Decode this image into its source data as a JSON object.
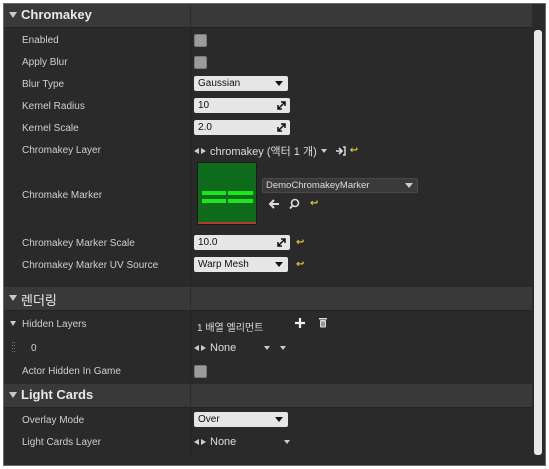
{
  "sections": {
    "chromakey": "Chromakey",
    "rendering": "렌더링",
    "light_cards": "Light Cards"
  },
  "chromakey": {
    "enabled_label": "Enabled",
    "apply_blur_label": "Apply Blur",
    "blur_type_label": "Blur Type",
    "blur_type_value": "Gaussian",
    "kernel_radius_label": "Kernel Radius",
    "kernel_radius_value": "10",
    "kernel_scale_label": "Kernel Scale",
    "kernel_scale_value": "2.0",
    "layer_label": "Chromakey Layer",
    "layer_value": "chromakey (액터 1 개)",
    "marker_label": "Chromake Marker",
    "marker_asset": "DemoChromakeyMarker",
    "marker_scale_label": "Chromakey Marker Scale",
    "marker_scale_value": "10.0",
    "uv_source_label": "Chromakey Marker UV Source",
    "uv_source_value": "Warp Mesh"
  },
  "rendering": {
    "hidden_layers_label": "Hidden Layers",
    "hidden_layers_count": "1 배열 엘리먼트",
    "element_index": "0",
    "element_value": "None",
    "actor_hidden_label": "Actor Hidden In Game"
  },
  "light_cards": {
    "overlay_mode_label": "Overlay Mode",
    "overlay_mode_value": "Over",
    "layer_label": "Light Cards Layer",
    "layer_value": "None"
  },
  "colors": {
    "panel_bg": "#2a2a2a",
    "section_bg": "#393939",
    "reset_arrow": "#d4c53a",
    "marker_green": "#0e6b1b"
  }
}
